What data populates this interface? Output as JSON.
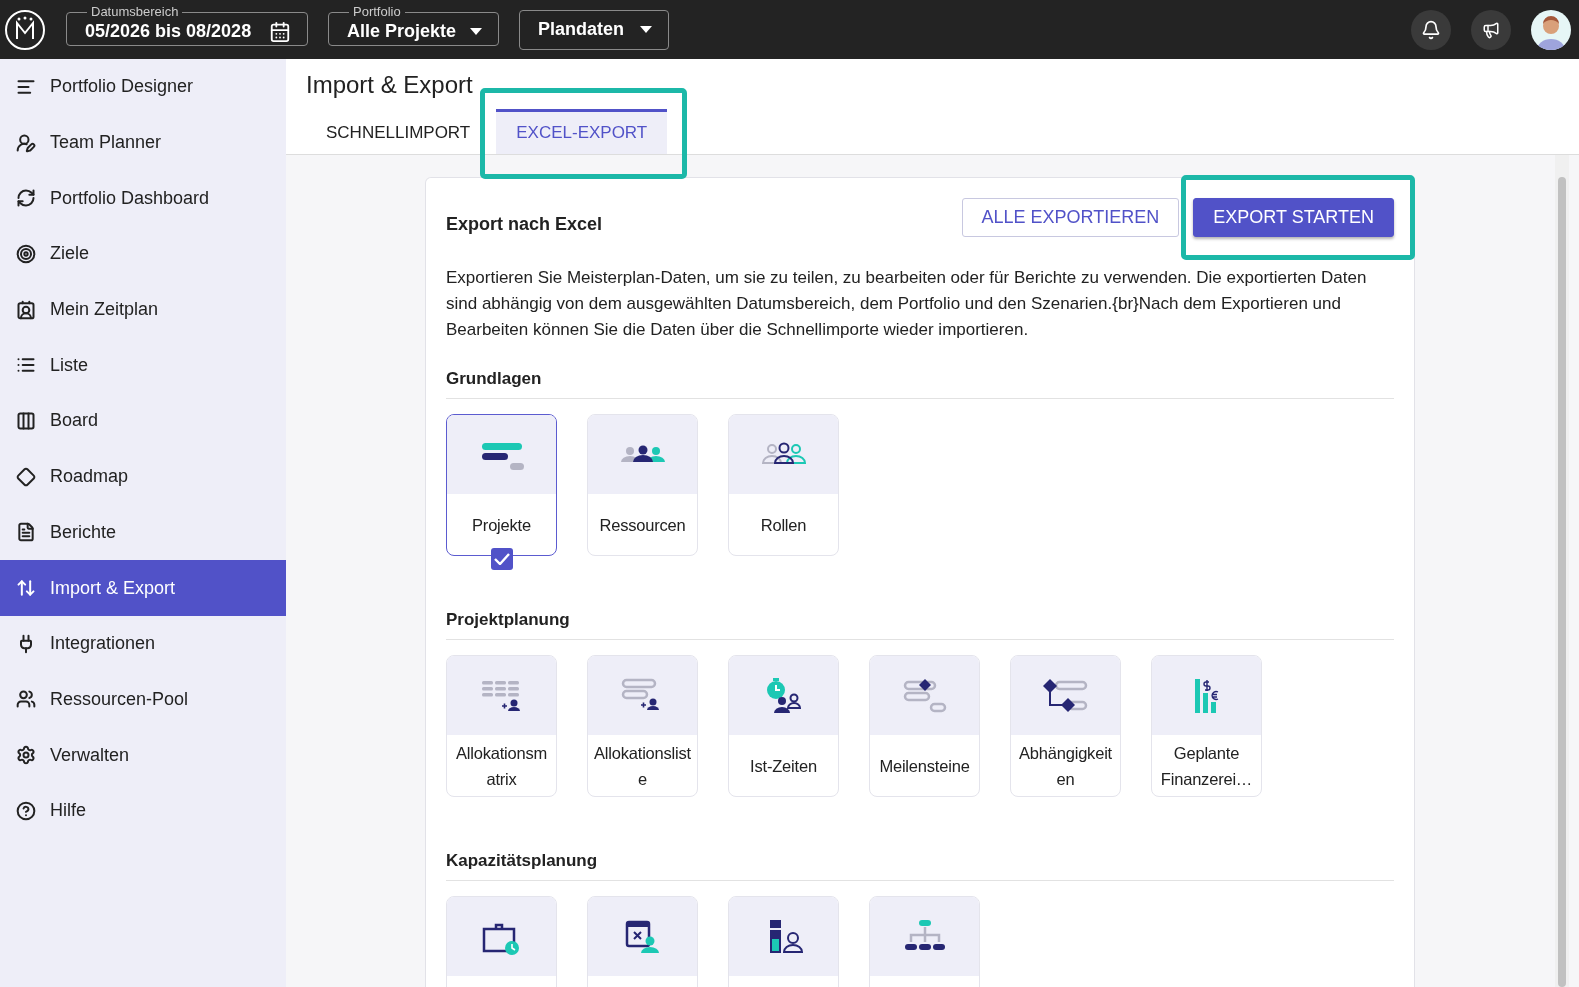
{
  "topbar": {
    "filters": [
      {
        "kind": "date",
        "label": "Datumsbereich",
        "value": "05/2026 bis 08/2028"
      },
      {
        "kind": "select",
        "label": "Portfolio",
        "value": "Alle Projekte"
      },
      {
        "kind": "select",
        "value": "Plandaten"
      }
    ]
  },
  "sidebar": {
    "items": [
      {
        "label": "Portfolio Designer",
        "selected": false
      },
      {
        "label": "Team Planner",
        "selected": false
      },
      {
        "label": "Portfolio Dashboard",
        "selected": false
      },
      {
        "label": "Ziele",
        "selected": false
      },
      {
        "label": "Mein Zeitplan",
        "selected": false
      },
      {
        "label": "Liste",
        "selected": false
      },
      {
        "label": "Board",
        "selected": false
      },
      {
        "label": "Roadmap",
        "selected": false
      },
      {
        "label": "Berichte",
        "selected": false
      },
      {
        "label": "Import & Export",
        "selected": true
      },
      {
        "label": "Integrationen",
        "selected": false
      },
      {
        "label": "Ressourcen-Pool",
        "selected": false
      },
      {
        "label": "Verwalten",
        "selected": false
      },
      {
        "label": "Hilfe",
        "selected": false
      }
    ]
  },
  "page": {
    "title": "Import & Export",
    "tabs": [
      {
        "label": "SCHNELLIMPORT",
        "selected": false,
        "highlighted": false
      },
      {
        "label": "EXCEL-EXPORT",
        "selected": true,
        "highlighted": true
      }
    ]
  },
  "card": {
    "title": "Export nach Excel",
    "buttons": [
      {
        "label": "ALLE EXPORTIEREN",
        "kind": "outlined",
        "highlighted": false
      },
      {
        "label": "EXPORT STARTEN",
        "kind": "primary",
        "highlighted": true
      }
    ],
    "description": "Exportieren Sie Meisterplan-Daten, um sie zu teilen, zu bearbeiten oder für Berichte zu verwenden. Die exportierten Daten sind abhängig von dem ausgewählten Datumsbereich, dem Portfolio und den Szenarien.{br}Nach dem Exportieren und Bearbeiten können Sie die Daten über die Schnellimporte wieder importieren.",
    "sections": [
      {
        "title": "Grundlagen",
        "tiles": [
          {
            "label": "Projekte",
            "checked": true
          },
          {
            "label": "Ressourcen",
            "checked": false
          },
          {
            "label": "Rollen",
            "checked": false
          }
        ]
      },
      {
        "title": "Projektplanung",
        "tiles": [
          {
            "label": "Allokationsmatrix",
            "checked": false
          },
          {
            "label": "Allokationsliste",
            "checked": false
          },
          {
            "label": "Ist-Zeiten",
            "checked": false
          },
          {
            "label": "Meilensteine",
            "checked": false
          },
          {
            "label": "Abhängigkeiten",
            "checked": false
          },
          {
            "label": "Geplante Finanzerei…",
            "checked": false
          }
        ]
      },
      {
        "title": "Kapazitätsplanung",
        "tiles": [
          {
            "checked": false
          },
          {
            "checked": false
          },
          {
            "checked": false
          },
          {
            "checked": false
          }
        ]
      }
    ]
  }
}
